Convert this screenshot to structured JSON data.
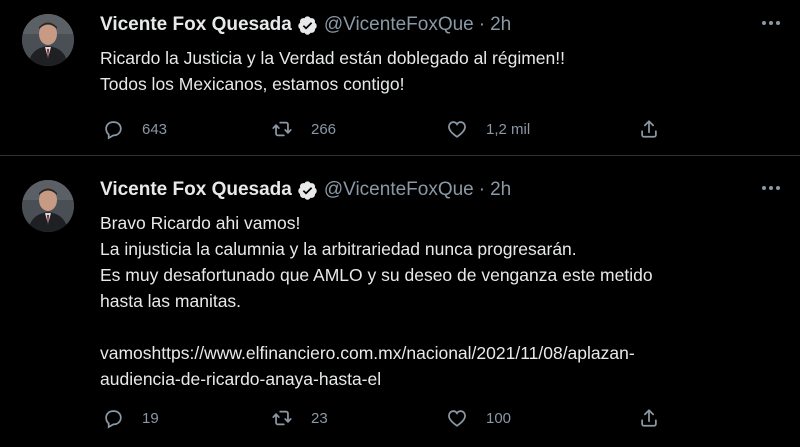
{
  "accent_color": "#1d9bf0",
  "tweets": [
    {
      "display_name": "Vicente Fox Quesada",
      "verified_icon": "verified-badge-icon",
      "handle": "@VicenteFoxQue",
      "separator": "·",
      "time": "2h",
      "text_lines": [
        "Ricardo la Justicia y la Verdad están doblegado al régimen!!",
        "Todos los Mexicanos, estamos contigo!"
      ],
      "replies": "643",
      "retweets": "266",
      "likes": "1,2 mil"
    },
    {
      "display_name": "Vicente Fox Quesada",
      "verified_icon": "verified-badge-icon",
      "handle": "@VicenteFoxQue",
      "separator": "·",
      "time": "2h",
      "text_lines": [
        "Bravo Ricardo ahi vamos!",
        "La injusticia la calumnia y la arbitrariedad nunca progresarán.",
        "Es muy desafortunado que AMLO y su deseo de venganza este metido",
        "hasta las manitas.",
        "",
        "vamoshttps://www.elfinanciero.com.mx/nacional/2021/11/08/aplazan-",
        "audiencia-de-ricardo-anaya-hasta-el"
      ],
      "replies": "19",
      "retweets": "23",
      "likes": "100"
    }
  ]
}
